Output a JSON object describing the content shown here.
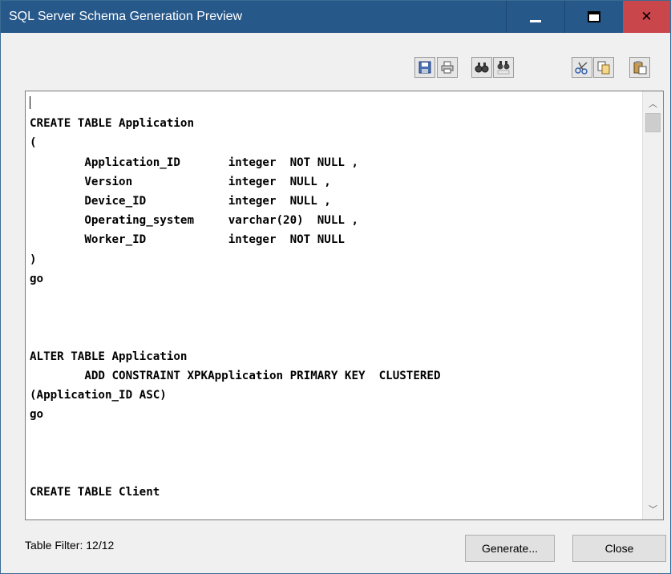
{
  "window": {
    "title": "SQL Server Schema Generation Preview"
  },
  "toolbar": {
    "icons": [
      "save-icon",
      "print-icon",
      "find-icon",
      "find-replace-icon",
      "cut-icon",
      "copy-icon",
      "paste-icon"
    ]
  },
  "editor": {
    "code": "\nCREATE TABLE Application\n(\n        Application_ID       integer  NOT NULL ,\n        Version              integer  NULL ,\n        Device_ID            integer  NULL ,\n        Operating_system     varchar(20)  NULL ,\n        Worker_ID            integer  NOT NULL\n)\ngo\n\n\n\nALTER TABLE Application\n        ADD CONSTRAINT XPKApplication PRIMARY KEY  CLUSTERED\n(Application_ID ASC)\ngo\n\n\n\nCREATE TABLE Client"
  },
  "footer": {
    "filter_label": "Table Filter: 12/12",
    "generate_label": "Generate...",
    "close_label": "Close"
  },
  "colors": {
    "titlebar": "#27588a",
    "close_button": "#c9464a"
  }
}
